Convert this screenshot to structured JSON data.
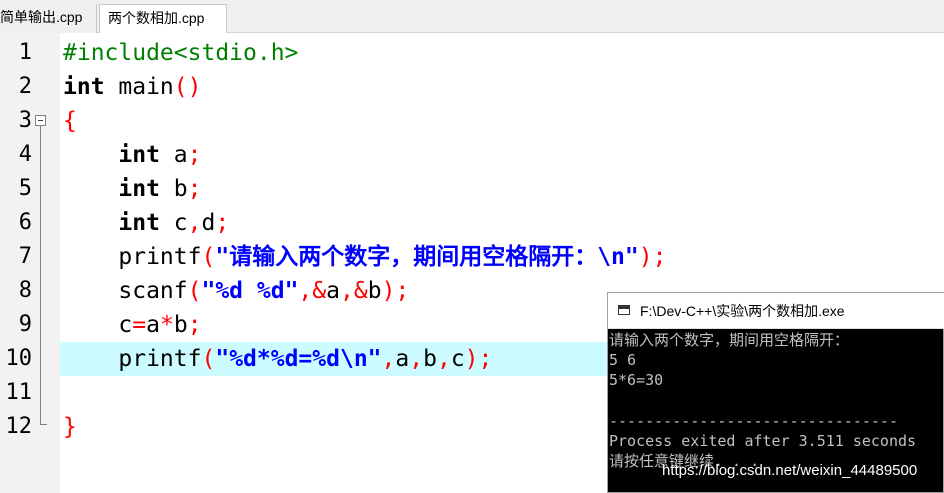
{
  "tabs": [
    {
      "label": "简单输出.cpp",
      "active": false
    },
    {
      "label": "两个数相加.cpp",
      "active": true
    }
  ],
  "editor": {
    "highlighted_line": 10,
    "lines": [
      {
        "num": "1",
        "tokens": [
          [
            "pp",
            "#include<stdio.h>"
          ]
        ]
      },
      {
        "num": "2",
        "tokens": [
          [
            "kw",
            "int"
          ],
          [
            "",
            " main"
          ],
          [
            "pun",
            "()"
          ]
        ]
      },
      {
        "num": "3",
        "tokens": [
          [
            "pun",
            "{"
          ]
        ]
      },
      {
        "num": "4",
        "tokens": [
          [
            "",
            "    "
          ],
          [
            "kw",
            "int"
          ],
          [
            "",
            " a"
          ],
          [
            "pun",
            ";"
          ]
        ]
      },
      {
        "num": "5",
        "tokens": [
          [
            "",
            "    "
          ],
          [
            "kw",
            "int"
          ],
          [
            "",
            " b"
          ],
          [
            "pun",
            ";"
          ]
        ]
      },
      {
        "num": "6",
        "tokens": [
          [
            "",
            "    "
          ],
          [
            "kw",
            "int"
          ],
          [
            "",
            " c"
          ],
          [
            "pun",
            ","
          ],
          [
            "",
            "d"
          ],
          [
            "pun",
            ";"
          ]
        ]
      },
      {
        "num": "7",
        "tokens": [
          [
            "",
            "    printf"
          ],
          [
            "pun",
            "("
          ],
          [
            "str",
            "\"请输入两个数字，期间用空格隔开：\\n\""
          ],
          [
            "pun",
            ");"
          ]
        ]
      },
      {
        "num": "8",
        "tokens": [
          [
            "",
            "    scanf"
          ],
          [
            "pun",
            "("
          ],
          [
            "str",
            "\"%d %d\""
          ],
          [
            "pun",
            ","
          ],
          [
            "pun",
            "&"
          ],
          [
            "",
            "a"
          ],
          [
            "pun",
            ","
          ],
          [
            "pun",
            "&"
          ],
          [
            "",
            "b"
          ],
          [
            "pun",
            ");"
          ]
        ]
      },
      {
        "num": "9",
        "tokens": [
          [
            "",
            "    c"
          ],
          [
            "pun",
            "="
          ],
          [
            "",
            "a"
          ],
          [
            "pun",
            "*"
          ],
          [
            "",
            "b"
          ],
          [
            "pun",
            ";"
          ]
        ]
      },
      {
        "num": "10",
        "tokens": [
          [
            "",
            "    printf"
          ],
          [
            "pun",
            "("
          ],
          [
            "str",
            "\"%d*%d=%d\\n\""
          ],
          [
            "pun",
            ","
          ],
          [
            "",
            "a"
          ],
          [
            "pun",
            ","
          ],
          [
            "",
            "b"
          ],
          [
            "pun",
            ","
          ],
          [
            "",
            "c"
          ],
          [
            "pun",
            ");"
          ]
        ]
      },
      {
        "num": "11",
        "tokens": []
      },
      {
        "num": "12",
        "tokens": [
          [
            "pun",
            "}"
          ]
        ]
      }
    ]
  },
  "console": {
    "title": "F:\\Dev-C++\\实验\\两个数相加.exe",
    "lines": [
      "请输入两个数字，期间用空格隔开：",
      "5 6",
      "5*6=30",
      "",
      "--------------------------------",
      "Process exited after 3.511 seconds",
      "请按任意键继续. . ."
    ]
  },
  "watermark": "https://blog.csdn.net/weixin_44489500"
}
